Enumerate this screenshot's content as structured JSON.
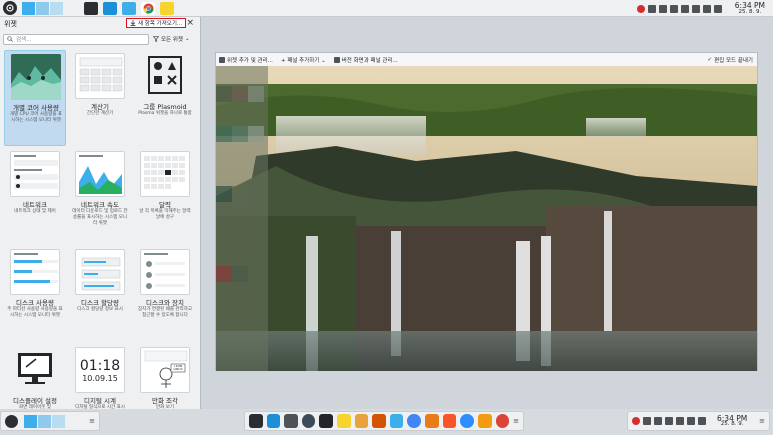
{
  "top_panel": {
    "clock_time": "6:34 PM",
    "clock_date": "25. 8. 9."
  },
  "widget_explorer": {
    "title": "위젯",
    "get_new_label": "새 항목 가져오기...",
    "search_placeholder": "검색...",
    "filter_label": "모든 위젯",
    "widgets": [
      {
        "name": "개별 코어 사용량",
        "desc": "개별 CPU 코어 사용량을 표시하는 시스템 모니터 위젯"
      },
      {
        "name": "계산기",
        "desc": "간단한 계산기"
      },
      {
        "name": "그룹 Plasmoid",
        "desc": "Plasma 위젯을 하나로 통합"
      },
      {
        "name": "네트워크",
        "desc": "네트워크 상태 및 제어"
      },
      {
        "name": "네트워크 속도",
        "desc": "데이터 다운로드 및 업로드 전송률을 표시하는 시스템 모니터 위젯"
      },
      {
        "name": "달력",
        "desc": "날 각 목록을 막해주는 달력 날에 성구"
      },
      {
        "name": "디스크 사용량",
        "desc": "주 파티션 사용량 사용량을 표시하는 시스템 모니터 위젯"
      },
      {
        "name": "디스크 할당량",
        "desc": "디스크 할당량 정보 표시"
      },
      {
        "name": "디스크와 장치",
        "desc": "장치가 연결된 때를 관리하고 접근할 수 있도록 합니다"
      },
      {
        "name": "디스플레이 설정",
        "desc": "화면 레이아웃 및"
      },
      {
        "name": "디지털 시계",
        "desc": "디지털 형식으로 시간 표시"
      },
      {
        "name": "만화 조각",
        "desc": "만화 보기"
      }
    ],
    "clock_preview_time": "01:18",
    "clock_preview_date": "10.09.15",
    "comic_text": "I RUN LINUX",
    "calc_keys": [
      "7",
      "8",
      "9",
      "4",
      "5",
      "6",
      "1",
      "2",
      "3",
      "0",
      ".",
      "="
    ],
    "net_rows": [
      "Active connections",
      "Previous connections"
    ],
    "dev_rows": [
      "removable media",
      "optical media",
      "flash card"
    ]
  },
  "wallpaper_window": {
    "add_widget_label": "위젯 추가 및 관리...",
    "add_panel_label": "패널 추가하기",
    "virtual_screen_label": "버전 화면과 패널 관리...",
    "done_label": "편집 모드 끝내기"
  },
  "bottom_panel": {
    "clock_time": "6:34 PM",
    "clock_date": "25. 8. 9."
  },
  "colors": {
    "accent": "#3daee9",
    "selection": "#c2daf0",
    "highlight_border": "#e0101a"
  }
}
